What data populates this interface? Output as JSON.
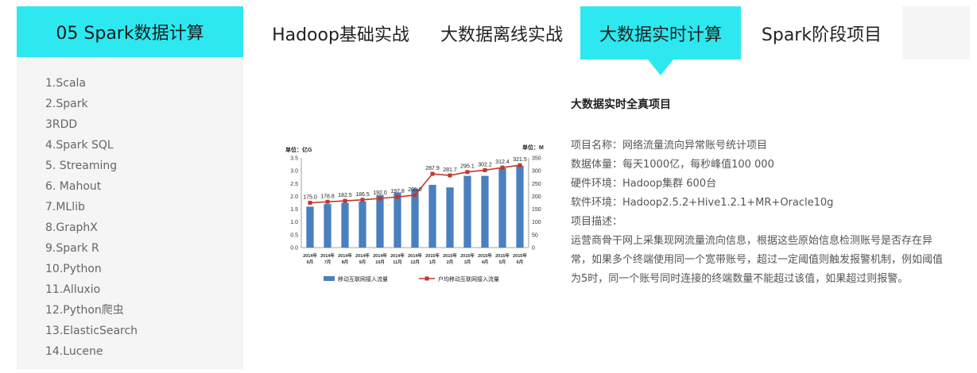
{
  "sidebar": {
    "title": "05 Spark数据计算",
    "items": [
      "1.Scala",
      "2.Spark",
      "3RDD",
      "4.Spark SQL",
      "5. Streaming",
      "6. Mahout",
      "7.MLlib",
      "8.GraphX",
      "9.Spark R",
      "10.Python",
      "11.Alluxio",
      "12.Python爬虫",
      "13.ElasticSearch",
      "14.Lucene"
    ]
  },
  "tabs": [
    {
      "label": "Hadoop基础实战"
    },
    {
      "label": "大数据离线实战"
    },
    {
      "label": "大数据实时计算",
      "active": true
    },
    {
      "label": "Spark阶段项目"
    }
  ],
  "project": {
    "title": "大数据实时全真项目",
    "rows": [
      "项目名称：网络流量流向异常账号统计项目",
      "数据体量：每天1000亿，每秒峰值100 000",
      "硬件环境：Hadoop集群 600台",
      "软件环境：Hadoop2.5.2+Hive1.2.1+MR+Oracle10g",
      "项目描述："
    ],
    "description": "运营商骨干网上采集现网流量流向信息，根据这些原始信息检测账号是否存在异常，如果多个终端使用同一个宽带账号，超过一定阈值则触发报警机制，例如阈值为5时，同一个账号同时连接的终端数量不能超过该值，如果超过则报警。"
  },
  "chart_data": {
    "type": "bar",
    "left_unit": "单位：亿G",
    "right_unit": "单位：M",
    "categories": [
      "2014年 6月",
      "2014年 7月",
      "2014年 8月",
      "2014年 9月",
      "2014年 10月",
      "2014年 11月",
      "2014年 12月",
      "2015年 1月",
      "2015年 2月",
      "2015年 3月",
      "2015年 4月",
      "2015年 5月",
      "2015年 6月"
    ],
    "y_left_ticks": [
      "3.5",
      "3.0",
      "2.5",
      "2.0",
      "1.5",
      "1.0",
      "0.5",
      "0.0"
    ],
    "y_right_ticks": [
      "350",
      "300",
      "250",
      "200",
      "150",
      "100",
      "50",
      "0"
    ],
    "ylim_left": [
      0,
      3.5
    ],
    "ylim_right": [
      0,
      350
    ],
    "series": [
      {
        "name": "移动互联网接入流量",
        "kind": "bar",
        "axis": "left",
        "color": "#4a7fc0",
        "values": [
          1.6,
          1.7,
          1.75,
          1.8,
          2.05,
          2.15,
          2.3,
          2.45,
          2.35,
          2.8,
          2.8,
          3.1,
          3.2
        ]
      },
      {
        "name": "户均移动互联网接入流量",
        "kind": "line",
        "axis": "right",
        "color": "#c0392b",
        "values": [
          175.0,
          178.8,
          182.5,
          186.5,
          192.0,
          197.8,
          205.0,
          287.9,
          281.7,
          295.1,
          302.2,
          312.4,
          321.5
        ],
        "labels": [
          "175.0",
          "178.8",
          "182.5",
          "186.5",
          "192.0",
          "197.8",
          "205.0",
          "287.9",
          "281.7",
          "295.1",
          "302.2",
          "312.4",
          "321.5"
        ]
      }
    ]
  }
}
